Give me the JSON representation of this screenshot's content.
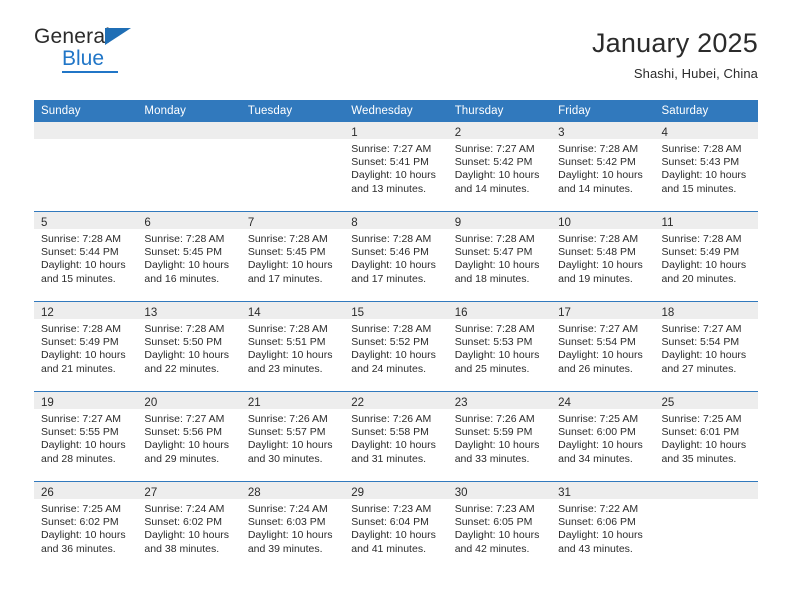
{
  "brand": {
    "name_top": "General",
    "name_bottom": "Blue",
    "triangle_color": "#1f6eb5",
    "blue_color": "#2176c7"
  },
  "header": {
    "title": "January 2025",
    "subtitle": "Shashi, Hubei, China"
  },
  "theme": {
    "header_row_bg": "#3179bd",
    "daynum_band_bg": "#ededed",
    "grid_line": "#3179bd",
    "text": "#2b2b2b"
  },
  "weekdays": [
    "Sunday",
    "Monday",
    "Tuesday",
    "Wednesday",
    "Thursday",
    "Friday",
    "Saturday"
  ],
  "labels": {
    "sunrise_prefix": "Sunrise: ",
    "sunset_prefix": "Sunset: ",
    "daylight_prefix": "Daylight: "
  },
  "weeks": [
    [
      {
        "day": "",
        "empty": true
      },
      {
        "day": "",
        "empty": true
      },
      {
        "day": "",
        "empty": true
      },
      {
        "day": "1",
        "sunrise": "Sunrise: 7:27 AM",
        "sunset": "Sunset: 5:41 PM",
        "daylight_line1": "Daylight: 10 hours",
        "daylight_line2": "and 13 minutes."
      },
      {
        "day": "2",
        "sunrise": "Sunrise: 7:27 AM",
        "sunset": "Sunset: 5:42 PM",
        "daylight_line1": "Daylight: 10 hours",
        "daylight_line2": "and 14 minutes."
      },
      {
        "day": "3",
        "sunrise": "Sunrise: 7:28 AM",
        "sunset": "Sunset: 5:42 PM",
        "daylight_line1": "Daylight: 10 hours",
        "daylight_line2": "and 14 minutes."
      },
      {
        "day": "4",
        "sunrise": "Sunrise: 7:28 AM",
        "sunset": "Sunset: 5:43 PM",
        "daylight_line1": "Daylight: 10 hours",
        "daylight_line2": "and 15 minutes."
      }
    ],
    [
      {
        "day": "5",
        "sunrise": "Sunrise: 7:28 AM",
        "sunset": "Sunset: 5:44 PM",
        "daylight_line1": "Daylight: 10 hours",
        "daylight_line2": "and 15 minutes."
      },
      {
        "day": "6",
        "sunrise": "Sunrise: 7:28 AM",
        "sunset": "Sunset: 5:45 PM",
        "daylight_line1": "Daylight: 10 hours",
        "daylight_line2": "and 16 minutes."
      },
      {
        "day": "7",
        "sunrise": "Sunrise: 7:28 AM",
        "sunset": "Sunset: 5:45 PM",
        "daylight_line1": "Daylight: 10 hours",
        "daylight_line2": "and 17 minutes."
      },
      {
        "day": "8",
        "sunrise": "Sunrise: 7:28 AM",
        "sunset": "Sunset: 5:46 PM",
        "daylight_line1": "Daylight: 10 hours",
        "daylight_line2": "and 17 minutes."
      },
      {
        "day": "9",
        "sunrise": "Sunrise: 7:28 AM",
        "sunset": "Sunset: 5:47 PM",
        "daylight_line1": "Daylight: 10 hours",
        "daylight_line2": "and 18 minutes."
      },
      {
        "day": "10",
        "sunrise": "Sunrise: 7:28 AM",
        "sunset": "Sunset: 5:48 PM",
        "daylight_line1": "Daylight: 10 hours",
        "daylight_line2": "and 19 minutes."
      },
      {
        "day": "11",
        "sunrise": "Sunrise: 7:28 AM",
        "sunset": "Sunset: 5:49 PM",
        "daylight_line1": "Daylight: 10 hours",
        "daylight_line2": "and 20 minutes."
      }
    ],
    [
      {
        "day": "12",
        "sunrise": "Sunrise: 7:28 AM",
        "sunset": "Sunset: 5:49 PM",
        "daylight_line1": "Daylight: 10 hours",
        "daylight_line2": "and 21 minutes."
      },
      {
        "day": "13",
        "sunrise": "Sunrise: 7:28 AM",
        "sunset": "Sunset: 5:50 PM",
        "daylight_line1": "Daylight: 10 hours",
        "daylight_line2": "and 22 minutes."
      },
      {
        "day": "14",
        "sunrise": "Sunrise: 7:28 AM",
        "sunset": "Sunset: 5:51 PM",
        "daylight_line1": "Daylight: 10 hours",
        "daylight_line2": "and 23 minutes."
      },
      {
        "day": "15",
        "sunrise": "Sunrise: 7:28 AM",
        "sunset": "Sunset: 5:52 PM",
        "daylight_line1": "Daylight: 10 hours",
        "daylight_line2": "and 24 minutes."
      },
      {
        "day": "16",
        "sunrise": "Sunrise: 7:28 AM",
        "sunset": "Sunset: 5:53 PM",
        "daylight_line1": "Daylight: 10 hours",
        "daylight_line2": "and 25 minutes."
      },
      {
        "day": "17",
        "sunrise": "Sunrise: 7:27 AM",
        "sunset": "Sunset: 5:54 PM",
        "daylight_line1": "Daylight: 10 hours",
        "daylight_line2": "and 26 minutes."
      },
      {
        "day": "18",
        "sunrise": "Sunrise: 7:27 AM",
        "sunset": "Sunset: 5:54 PM",
        "daylight_line1": "Daylight: 10 hours",
        "daylight_line2": "and 27 minutes."
      }
    ],
    [
      {
        "day": "19",
        "sunrise": "Sunrise: 7:27 AM",
        "sunset": "Sunset: 5:55 PM",
        "daylight_line1": "Daylight: 10 hours",
        "daylight_line2": "and 28 minutes."
      },
      {
        "day": "20",
        "sunrise": "Sunrise: 7:27 AM",
        "sunset": "Sunset: 5:56 PM",
        "daylight_line1": "Daylight: 10 hours",
        "daylight_line2": "and 29 minutes."
      },
      {
        "day": "21",
        "sunrise": "Sunrise: 7:26 AM",
        "sunset": "Sunset: 5:57 PM",
        "daylight_line1": "Daylight: 10 hours",
        "daylight_line2": "and 30 minutes."
      },
      {
        "day": "22",
        "sunrise": "Sunrise: 7:26 AM",
        "sunset": "Sunset: 5:58 PM",
        "daylight_line1": "Daylight: 10 hours",
        "daylight_line2": "and 31 minutes."
      },
      {
        "day": "23",
        "sunrise": "Sunrise: 7:26 AM",
        "sunset": "Sunset: 5:59 PM",
        "daylight_line1": "Daylight: 10 hours",
        "daylight_line2": "and 33 minutes."
      },
      {
        "day": "24",
        "sunrise": "Sunrise: 7:25 AM",
        "sunset": "Sunset: 6:00 PM",
        "daylight_line1": "Daylight: 10 hours",
        "daylight_line2": "and 34 minutes."
      },
      {
        "day": "25",
        "sunrise": "Sunrise: 7:25 AM",
        "sunset": "Sunset: 6:01 PM",
        "daylight_line1": "Daylight: 10 hours",
        "daylight_line2": "and 35 minutes."
      }
    ],
    [
      {
        "day": "26",
        "sunrise": "Sunrise: 7:25 AM",
        "sunset": "Sunset: 6:02 PM",
        "daylight_line1": "Daylight: 10 hours",
        "daylight_line2": "and 36 minutes."
      },
      {
        "day": "27",
        "sunrise": "Sunrise: 7:24 AM",
        "sunset": "Sunset: 6:02 PM",
        "daylight_line1": "Daylight: 10 hours",
        "daylight_line2": "and 38 minutes."
      },
      {
        "day": "28",
        "sunrise": "Sunrise: 7:24 AM",
        "sunset": "Sunset: 6:03 PM",
        "daylight_line1": "Daylight: 10 hours",
        "daylight_line2": "and 39 minutes."
      },
      {
        "day": "29",
        "sunrise": "Sunrise: 7:23 AM",
        "sunset": "Sunset: 6:04 PM",
        "daylight_line1": "Daylight: 10 hours",
        "daylight_line2": "and 41 minutes."
      },
      {
        "day": "30",
        "sunrise": "Sunrise: 7:23 AM",
        "sunset": "Sunset: 6:05 PM",
        "daylight_line1": "Daylight: 10 hours",
        "daylight_line2": "and 42 minutes."
      },
      {
        "day": "31",
        "sunrise": "Sunrise: 7:22 AM",
        "sunset": "Sunset: 6:06 PM",
        "daylight_line1": "Daylight: 10 hours",
        "daylight_line2": "and 43 minutes."
      },
      {
        "day": "",
        "empty": true
      }
    ]
  ]
}
